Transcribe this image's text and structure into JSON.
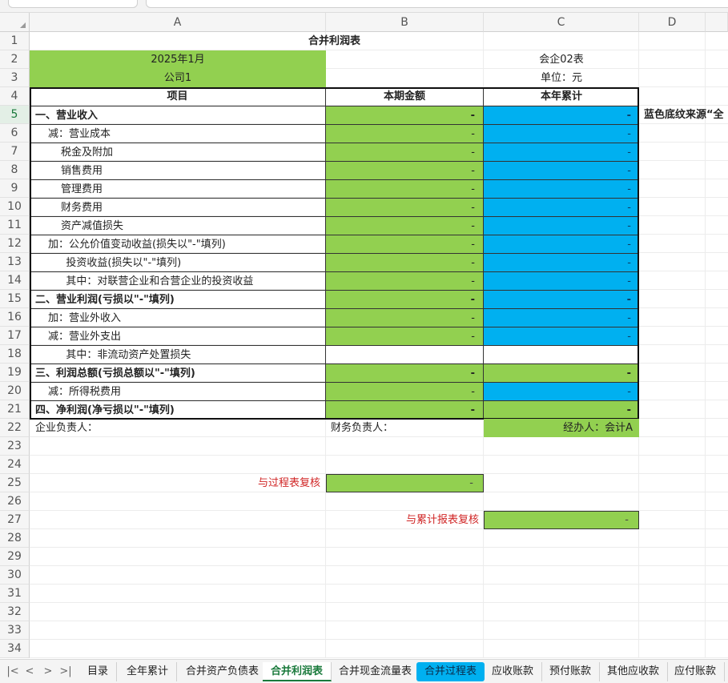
{
  "columns": [
    "A",
    "B",
    "C",
    "D"
  ],
  "rows": [
    "1",
    "2",
    "3",
    "4",
    "5",
    "6",
    "7",
    "8",
    "9",
    "10",
    "11",
    "12",
    "13",
    "14",
    "15",
    "16",
    "17",
    "18",
    "19",
    "20",
    "21",
    "22",
    "23",
    "24",
    "25",
    "26",
    "27",
    "28",
    "29",
    "30",
    "31",
    "32",
    "33",
    "34"
  ],
  "selected_row": "5",
  "sheet": {
    "title": "合并利润表",
    "period": "2025年1月",
    "form_code": "会企02表",
    "company": "公司1",
    "unit": "单位：元",
    "headers": {
      "item": "项目",
      "current": "本期金额",
      "ytd": "本年累计"
    },
    "lines": [
      {
        "label": "一、营业收入",
        "current": "-",
        "ytd": "-"
      },
      {
        "label": "减：营业成本",
        "current": "-",
        "ytd": "-"
      },
      {
        "label": "税金及附加",
        "current": "-",
        "ytd": "-"
      },
      {
        "label": "销售费用",
        "current": "-",
        "ytd": "-"
      },
      {
        "label": "管理费用",
        "current": "-",
        "ytd": "-"
      },
      {
        "label": "财务费用",
        "current": "-",
        "ytd": "-"
      },
      {
        "label": "资产减值损失",
        "current": "-",
        "ytd": "-"
      },
      {
        "label": "加：公允价值变动收益(损失以\"-\"填列)",
        "current": "-",
        "ytd": "-"
      },
      {
        "label": "投资收益(损失以\"-\"填列)",
        "current": "-",
        "ytd": "-"
      },
      {
        "label": "其中：对联营企业和合营企业的投资收益",
        "current": "-",
        "ytd": "-"
      },
      {
        "label": "二、营业利润(亏损以\"-\"填列)",
        "current": "-",
        "ytd": "-"
      },
      {
        "label": "加：营业外收入",
        "current": "-",
        "ytd": "-"
      },
      {
        "label": "减：营业外支出",
        "current": "-",
        "ytd": "-"
      },
      {
        "label": "其中：非流动资产处置损失",
        "current": "",
        "ytd": ""
      },
      {
        "label": "三、利润总额(亏损总额以\"-\"填列)",
        "current": "-",
        "ytd": "-"
      },
      {
        "label": "减：所得税费用",
        "current": "-",
        "ytd": "-"
      },
      {
        "label": "四、净利润(净亏损以\"-\"填列)",
        "current": "-",
        "ytd": "-"
      }
    ],
    "note": "蓝色底纹来源“全",
    "signatures": {
      "head": "企业负责人：",
      "finance": "财务负责人：",
      "handler": "经办人：会计A"
    },
    "checks": [
      {
        "label": "与过程表复核",
        "value": "-"
      },
      {
        "label": "与累计报表复核",
        "value": "-"
      }
    ]
  },
  "tabs": [
    "目录",
    "全年累计",
    "合并资产负债表",
    "合并利润表",
    "合并现金流量表",
    "合并过程表",
    "应收账款",
    "预付账款",
    "其他应收款",
    "应付账款"
  ],
  "active_tab": "合并利润表",
  "nav": [
    "|<",
    "<",
    ">",
    ">|"
  ],
  "colors": {
    "green": "#92d050",
    "blue": "#00b0f0",
    "active_tab_text": "#1a7a3c",
    "check_label": "#d02525"
  }
}
